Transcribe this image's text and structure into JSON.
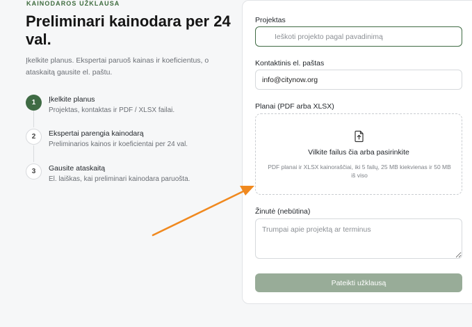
{
  "hero": {
    "eyebrow": "KAINODAROS UŽKLAUSA",
    "title": "Preliminari kainodara per 24 val.",
    "lead": "Įkelkite planus. Ekspertai paruoš kainas ir koeficientus, o ataskaitą gausite el. paštu."
  },
  "steps": [
    {
      "number": "1",
      "title": "Įkelkite planus",
      "description": "Projektas, kontaktas ir PDF / XLSX failai.",
      "state": "active"
    },
    {
      "number": "2",
      "title": "Ekspertai parengia kainodarą",
      "description": "Preliminarios kainos ir koeficientai per 24 val.",
      "state": "idle"
    },
    {
      "number": "3",
      "title": "Gausite ataskaitą",
      "description": "El. laiškas, kai preliminari kainodara paruošta.",
      "state": "idle"
    }
  ],
  "form": {
    "project_label": "Projektas",
    "project_placeholder": "Ieškoti projekto pagal pavadinimą",
    "email_label": "Kontaktinis el. paštas",
    "email_value": "info@citynow.org",
    "plans_label": "Planai (PDF arba XLSX)",
    "drop_title": "Vilkite failus čia arba pasirinkite",
    "drop_hint": "PDF planai ir XLSX kainoraščiai, iki 5 failų, 25 MB kiekvienas ir 50 MB iš viso",
    "message_label": "Žinutė (nebūtina)",
    "message_placeholder": "Trumpai apie projektą ar terminus",
    "submit_label": "Pateikti užklausą"
  },
  "icons": {
    "search": "search-icon",
    "upload": "file-upload-icon",
    "annotation": "arrow-annotation"
  },
  "colors": {
    "accent": "#3f6b44",
    "submit_disabled": "#98ac98",
    "annotation_arrow": "#f0891f"
  }
}
